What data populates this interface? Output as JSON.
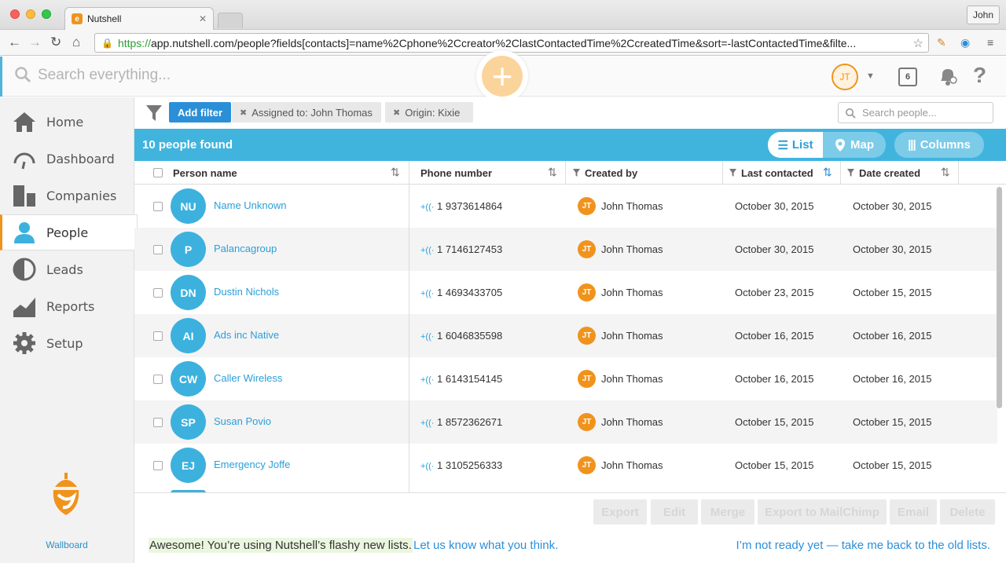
{
  "browser": {
    "tab_title": "Nutshell",
    "tab_icon_letter": "e",
    "profile_name": "John",
    "url_protocol": "https://",
    "url_rest": "app.nutshell.com/people?fields[contacts]=name%2Cphone%2Ccreator%2ClastContactedTime%2CcreatedTime&sort=-lastContactedTime&filte..."
  },
  "appbar": {
    "search_placeholder": "Search everything...",
    "user_initials": "JT",
    "calendar_day": "6"
  },
  "sidebar": {
    "items": [
      {
        "label": "Home",
        "icon": "home-icon"
      },
      {
        "label": "Dashboard",
        "icon": "gauge-icon"
      },
      {
        "label": "Companies",
        "icon": "building-icon"
      },
      {
        "label": "People",
        "icon": "person-icon"
      },
      {
        "label": "Leads",
        "icon": "half-circle-icon"
      },
      {
        "label": "Reports",
        "icon": "chart-icon"
      },
      {
        "label": "Setup",
        "icon": "gear-icon"
      }
    ],
    "active": "People",
    "wallboard": "Wallboard"
  },
  "filters": {
    "add_filter": "Add filter",
    "chips": [
      "Assigned to: John Thomas",
      "Origin: Kixie"
    ],
    "search_placeholder": "Search people..."
  },
  "results": {
    "count_text": "10 people found",
    "view_list": "List",
    "view_map": "Map",
    "columns": "Columns"
  },
  "table": {
    "headers": {
      "name": "Person name",
      "phone": "Phone number",
      "creator": "Created by",
      "last_contacted": "Last contacted",
      "date_created": "Date created"
    },
    "rows": [
      {
        "initials": "NU",
        "name": "Name Unknown",
        "phone": "1 9373614864",
        "creator_initials": "JT",
        "creator": "John Thomas",
        "last_contacted": "October 30, 2015",
        "date_created": "October 30, 2015"
      },
      {
        "initials": "P",
        "name": "Palancagroup",
        "phone": "1 7146127453",
        "creator_initials": "JT",
        "creator": "John Thomas",
        "last_contacted": "October 30, 2015",
        "date_created": "October 30, 2015"
      },
      {
        "initials": "DN",
        "name": "Dustin Nichols",
        "phone": "1 4693433705",
        "creator_initials": "JT",
        "creator": "John Thomas",
        "last_contacted": "October 23, 2015",
        "date_created": "October 15, 2015"
      },
      {
        "initials": "AI",
        "name": "Ads inc Native",
        "phone": "1 6046835598",
        "creator_initials": "JT",
        "creator": "John Thomas",
        "last_contacted": "October 16, 2015",
        "date_created": "October 16, 2015"
      },
      {
        "initials": "CW",
        "name": "Caller Wireless",
        "phone": "1 6143154145",
        "creator_initials": "JT",
        "creator": "John Thomas",
        "last_contacted": "October 16, 2015",
        "date_created": "October 16, 2015"
      },
      {
        "initials": "SP",
        "name": "Susan Povio",
        "phone": "1 8572362671",
        "creator_initials": "JT",
        "creator": "John Thomas",
        "last_contacted": "October 15, 2015",
        "date_created": "October 15, 2015"
      },
      {
        "initials": "EJ",
        "name": "Emergency Joffe",
        "phone": "1 3105256333",
        "creator_initials": "JT",
        "creator": "John Thomas",
        "last_contacted": "October 15, 2015",
        "date_created": "October 15, 2015"
      }
    ]
  },
  "actions": [
    "Export",
    "Edit",
    "Merge",
    "Export to MailChimp",
    "Email",
    "Delete"
  ],
  "feedback": {
    "awesome": "Awesome! You’re using Nutshell’s flashy new lists.",
    "let_us_know": "Let us know what you think.",
    "not_ready": "I’m not ready yet — take me back to the old lists."
  },
  "colors": {
    "accent": "#41b4de",
    "brand_orange": "#f0931d",
    "link": "#2b8fd8"
  }
}
